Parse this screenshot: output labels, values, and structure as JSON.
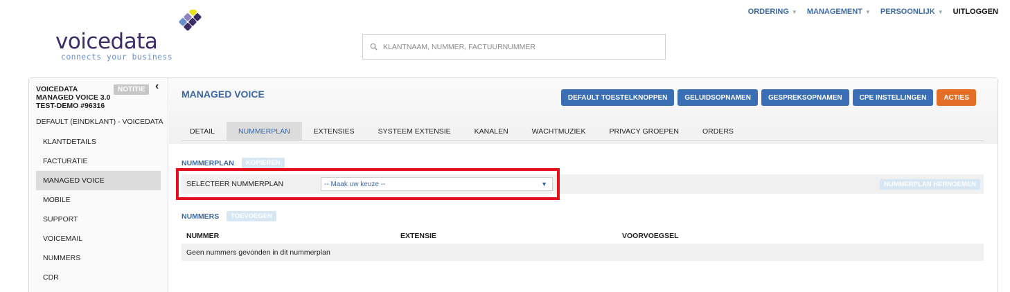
{
  "brand": {
    "name": "voicedata",
    "tagline": "connects your business"
  },
  "topnav": [
    {
      "label": "ORDERING",
      "dropdown": true
    },
    {
      "label": "MANAGEMENT",
      "dropdown": true
    },
    {
      "label": "PERSOONLIJK",
      "dropdown": true
    },
    {
      "label": "UITLOGGEN",
      "dropdown": false
    }
  ],
  "search": {
    "placeholder": "KLANTNAAM, NUMMER, FACTUURNUMMER",
    "value": ""
  },
  "sidebar": {
    "header_lines": [
      "VOICEDATA",
      "MANAGED VOICE 3.0",
      "TEST-DEMO #96316"
    ],
    "note_label": "NOTITIE",
    "subtitle": "DEFAULT (EINDKLANT) - VOICEDATA",
    "items": [
      {
        "label": "KLANTDETAILS",
        "active": false
      },
      {
        "label": "FACTURATIE",
        "active": false
      },
      {
        "label": "MANAGED VOICE",
        "active": true
      },
      {
        "label": "MOBILE",
        "active": false
      },
      {
        "label": "SUPPORT",
        "active": false
      },
      {
        "label": "VOICEMAIL",
        "active": false
      },
      {
        "label": "NUMMERS",
        "active": false
      },
      {
        "label": "CDR",
        "active": false
      }
    ]
  },
  "main": {
    "title": "MANAGED VOICE",
    "actions": [
      {
        "label": "DEFAULT TOESTELKNOPPEN",
        "color": "#3b6fb5"
      },
      {
        "label": "GELUIDSOPNAMEN",
        "color": "#3b6fb5"
      },
      {
        "label": "GESPREKSOPNAMEN",
        "color": "#3b6fb5"
      },
      {
        "label": "CPE INSTELLINGEN",
        "color": "#3b6fb5"
      },
      {
        "label": "ACTIES",
        "color": "#e46e26"
      }
    ],
    "tabs": [
      {
        "label": "DETAIL",
        "active": false
      },
      {
        "label": "NUMMERPLAN",
        "active": true
      },
      {
        "label": "EXTENSIES",
        "active": false
      },
      {
        "label": "SYSTEEM EXTENSIE",
        "active": false
      },
      {
        "label": "KANALEN",
        "active": false
      },
      {
        "label": "WACHTMUZIEK",
        "active": false
      },
      {
        "label": "PRIVACY GROEPEN",
        "active": false
      },
      {
        "label": "ORDERS",
        "active": false
      }
    ],
    "nummerplan": {
      "section_label": "NUMMERPLAN",
      "copy_label": "KOPIEREN",
      "select_label": "SELECTEER NUMMERPLAN",
      "select_value": "-- Maak uw keuze --",
      "rename_label": "NUMMERPLAN HERNOEMEN"
    },
    "nummers": {
      "section_label": "NUMMERS",
      "add_label": "TOEVOEGEN",
      "columns": [
        "NUMMER",
        "EXTENSIE",
        "VOORVOEGSEL"
      ],
      "empty_text": "Geen nummers gevonden in dit nummerplan"
    }
  },
  "colors": {
    "accent": "#3b67a3",
    "button": "#3b6fb5",
    "orange": "#e46e26",
    "highlight": "#e4101a"
  }
}
